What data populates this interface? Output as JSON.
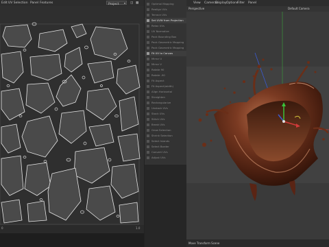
{
  "uv_editor": {
    "menu": {
      "edit": "Edit",
      "selection": "UV Selection",
      "panel": "Panel",
      "features": "Features"
    },
    "project_select": "Project",
    "status_left": "0",
    "status_right": "1.0"
  },
  "palette": {
    "items": [
      "Optimal Mapping",
      "Realign UVs",
      "Terrace UVs",
      "Set UVW from Projection",
      "Relax UVs",
      "UV Normalize",
      "Pack Bounding Box",
      "Pack Geometric Mapping",
      "Pack Geometric Mapping",
      "Fit UV to Canvas",
      "Mirror U",
      "Mirror V",
      "Rotate 90",
      "Rotate -90",
      "Fit Aspect",
      "Fit Aspect(width)",
      "Align Horizontal",
      "Straighten",
      "Rectangularize",
      "Unstack UVs",
      "Stack UVs",
      "Stitch UVs",
      "Break UVs",
      "Grow Selection",
      "Shrink Selection",
      "Select Islands",
      "Select Border",
      "Convert UVs",
      "Adjust UVs"
    ],
    "active_items": [
      "Set UVW from Projection",
      "Fit UV to Canvas"
    ]
  },
  "viewport": {
    "menu": [
      "View",
      "Cameras",
      "Display",
      "Options",
      "Filter",
      "Panel"
    ],
    "view_name": "Perspective",
    "camera_name": "Default Camera",
    "tool_hint": "Move",
    "status": "Move Transform Scene"
  },
  "colors": {
    "uv_background": "#2f2f2f",
    "uv_island_fill": "#4a4a4a",
    "uv_island_outline": "#e8e8e8",
    "chocolate": "#5a2a18",
    "axis_x": "#d23a3a",
    "axis_y": "#3ac23a",
    "axis_z": "#3a5ad2"
  }
}
